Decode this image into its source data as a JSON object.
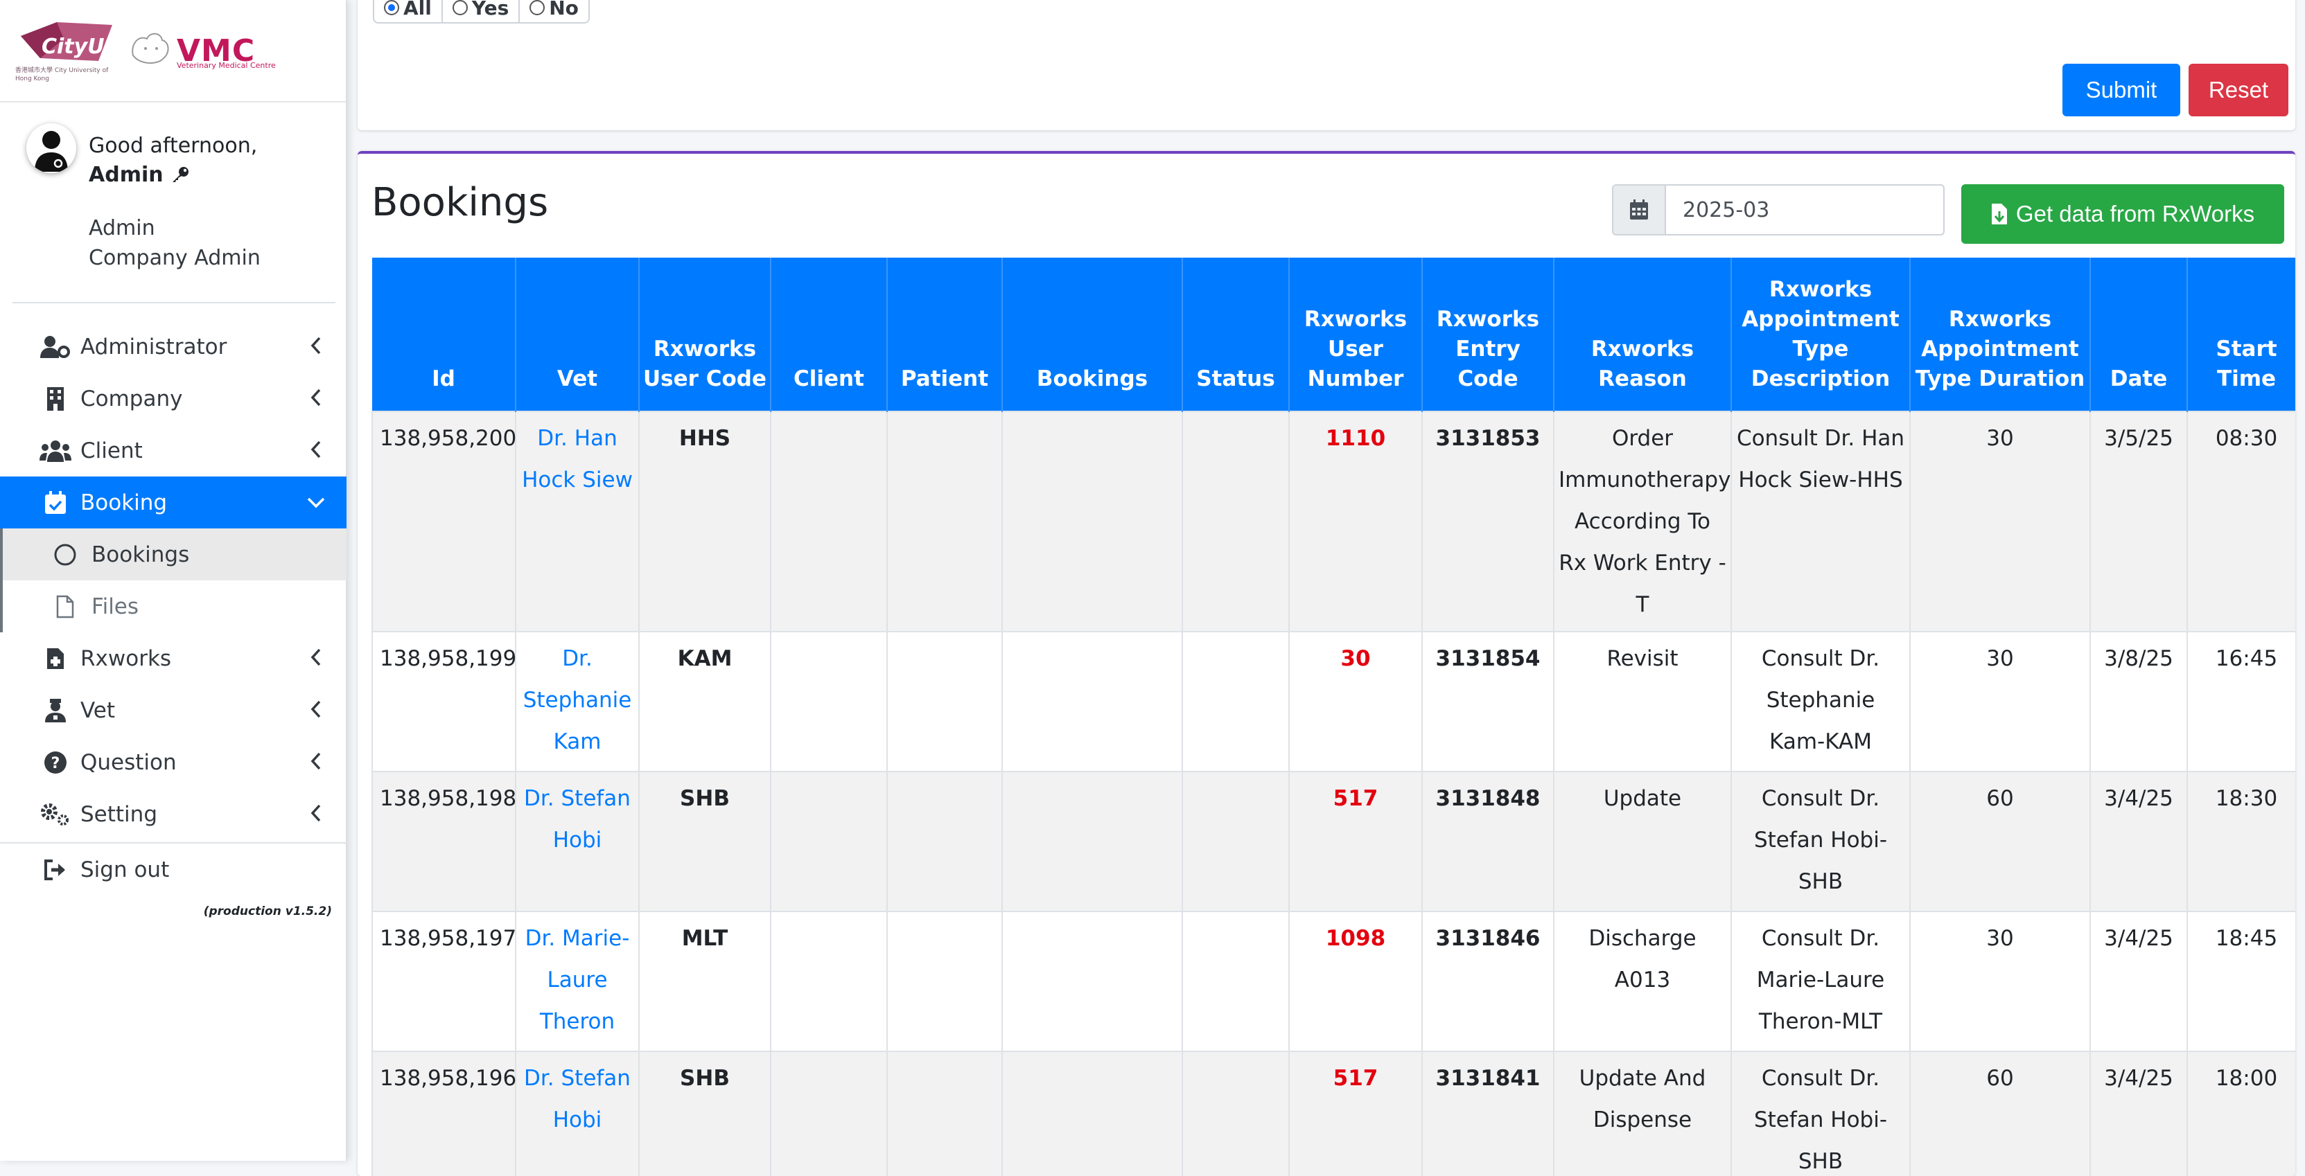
{
  "brand": {
    "cityu_name": "CityU",
    "cityu_sub": "香港城市大學 City University of Hong Kong",
    "vmc_name": "VMC",
    "vmc_sub": "Veterinary Medical Centre"
  },
  "user": {
    "greeting": "Good afternoon,",
    "name": "Admin",
    "role_line1": "Admin",
    "role_line2": "Company Admin"
  },
  "nav": {
    "administrator": "Administrator",
    "company": "Company",
    "client": "Client",
    "booking": "Booking",
    "bookings": "Bookings",
    "files": "Files",
    "rxworks": "Rxworks",
    "vet": "Vet",
    "question": "Question",
    "setting": "Setting",
    "signout": "Sign out",
    "version": "(production v1.5.2)"
  },
  "filter": {
    "options": [
      "All",
      "Yes",
      "No"
    ],
    "selected": "All",
    "submit_label": "Submit",
    "reset_label": "Reset"
  },
  "bookings": {
    "title": "Bookings",
    "month_value": "2025-03",
    "rx_button_label": "Get data from RxWorks",
    "columns": [
      "Id",
      "Vet",
      "Rxworks User Code",
      "Client",
      "Patient",
      "Bookings",
      "Status",
      "Rxworks User Number",
      "Rxworks Entry Code",
      "Rxworks Reason",
      "Rxworks Appointment Type Description",
      "Rxworks Appointment Type Duration",
      "Date",
      "Start Time"
    ],
    "rows": [
      [
        "138,958,200",
        "Dr. Han Hock Siew",
        "HHS",
        "",
        "",
        "",
        "",
        "1110",
        "3131853",
        "Order Immunotherapy According To Rx Work Entry - T",
        "Consult Dr. Han Hock Siew-HHS",
        "30",
        "3/5/25",
        "08:30"
      ],
      [
        "138,958,199",
        "Dr. Stephanie Kam",
        "KAM",
        "",
        "",
        "",
        "",
        "30",
        "3131854",
        "Revisit",
        "Consult Dr. Stephanie Kam-KAM",
        "30",
        "3/8/25",
        "16:45"
      ],
      [
        "138,958,198",
        "Dr. Stefan Hobi",
        "SHB",
        "",
        "",
        "",
        "",
        "517",
        "3131848",
        "Update",
        "Consult Dr. Stefan Hobi-SHB",
        "60",
        "3/4/25",
        "18:30"
      ],
      [
        "138,958,197",
        "Dr. Marie-Laure Theron",
        "MLT",
        "",
        "",
        "",
        "",
        "1098",
        "3131846",
        "Discharge A013",
        "Consult Dr. Marie-Laure Theron-MLT",
        "30",
        "3/4/25",
        "18:45"
      ],
      [
        "138,958,196",
        "Dr. Stefan Hobi",
        "SHB",
        "",
        "",
        "",
        "",
        "517",
        "3131841",
        "Update And Dispense",
        "Consult Dr. Stefan Hobi-SHB",
        "60",
        "3/4/25",
        "18:00"
      ]
    ]
  },
  "colors": {
    "primary": "#007bff",
    "danger": "#dc3545",
    "success": "#28a745",
    "user_number": "#e3000f",
    "card_accent": "#6f42c1"
  }
}
